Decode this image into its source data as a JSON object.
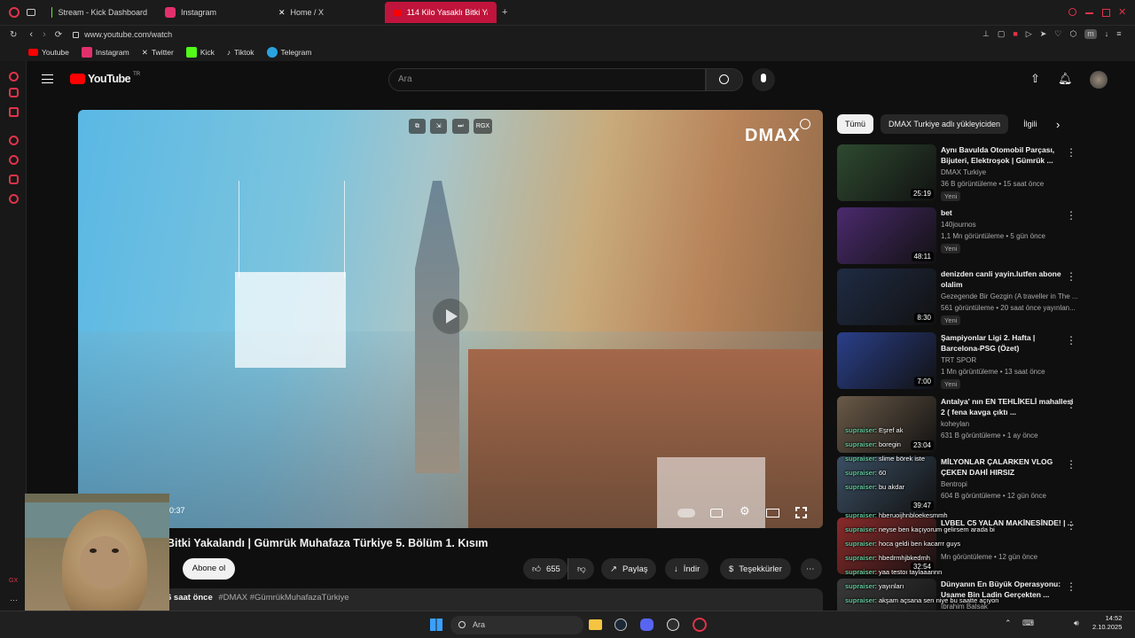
{
  "tabs": [
    {
      "label": "Stream - Kick Dashboard",
      "color": "#53fc18"
    },
    {
      "label": "Instagram",
      "color": "#e1306c"
    },
    {
      "label": "Home / X",
      "color": "#ffffff"
    },
    {
      "label": "114 Kilo Yasaklı Bitki Yaka",
      "color": "#ff0000",
      "active": true
    }
  ],
  "address": {
    "url": "www.youtube.com/watch"
  },
  "bookmarks": [
    "Youtube",
    "Instagram",
    "Twitter",
    "Kick",
    "Tiktok",
    "Telegram"
  ],
  "youtube": {
    "logo": "YouTube",
    "region": "TR",
    "search_placeholder": "Ara"
  },
  "player": {
    "brand": "DMAX",
    "time": "0:37",
    "ctrl_labels": [
      "⧉",
      "⇲",
      "⏭",
      "RGX"
    ]
  },
  "video": {
    "title": "Bitki Yakalandı | Gümrük Muhafaza Türkiye 5. Bölüm 1. Kısım",
    "subscribe": "Abone ol",
    "likes": "655",
    "share": "Paylaş",
    "download": "İndir",
    "thanks": "Teşekkürler",
    "desc_time": "6 saat önce",
    "desc_tags": "#DMAX #GümrükMuhafazaTürkiye"
  },
  "chips": [
    "Tümü",
    "DMAX Turkiye adlı yükleyiciden",
    "İlgili"
  ],
  "recommendations": [
    {
      "title": "Aynı Bavulda Otomobil Parçası, Bijuteri, Elektroşok | Gümrük ...",
      "channel": "DMAX Turkiye",
      "meta": "36 B görüntüleme • 15 saat önce",
      "badge": "Yeni",
      "duration": "25:19",
      "thumb": "#2e4a30"
    },
    {
      "title": "bet",
      "channel": "140journos",
      "meta": "1,1 Mn görüntüleme • 5 gün önce",
      "badge": "Yeni",
      "duration": "48:11",
      "thumb": "#4b2a6e"
    },
    {
      "title": "denizden canli yayin.lutfen abone olalim",
      "channel": "Gezegende Bir Gezgin (A traveller in The ...",
      "meta": "561 görüntüleme • 20 saat önce yayınlan...",
      "badge": "Yeni",
      "duration": "8:30",
      "thumb": "#1f2b44"
    },
    {
      "title": "Şampiyonlar Ligi 2. Hafta | Barcelona-PSG (Özet)",
      "channel": "TRT SPOR",
      "meta": "1 Mn görüntüleme • 13 saat önce",
      "badge": "Yeni",
      "duration": "7:00",
      "thumb": "#2a3f8a"
    },
    {
      "title": "Antalya' nın EN TEHLİKELİ mahallesi 2 ( fena kavga çıktı ...",
      "channel": "koheylan",
      "meta": "631 B görüntüleme • 1 ay önce",
      "badge": "",
      "duration": "23:04",
      "thumb": "#6a5a48"
    },
    {
      "title": "MİLYONLAR ÇALARKEN VLOG ÇEKEN DAHİ HIRSIZ",
      "channel": "Bentropi",
      "meta": "604 B görüntüleme • 12 gün önce",
      "badge": "",
      "duration": "39:47",
      "thumb": "#3b4f63"
    },
    {
      "title": "LVBEL C5 YALAN MAKİNESİNDE! | ...",
      "channel": "",
      "meta": "Mn görüntüleme • 12 gün önce",
      "badge": "",
      "duration": "32:54",
      "thumb": "#8a2a2a"
    },
    {
      "title": "Dünyanın En Büyük Operasyonu: Usame Bin Ladin Gerçekten ...",
      "channel": "İbrahim Balsak",
      "meta": "",
      "badge": "",
      "duration": "",
      "thumb": "#3a3a3a"
    }
  ],
  "chat": [
    {
      "name": "supraiser",
      "msg": ": Eşref ak"
    },
    {
      "name": "supraiser",
      "msg": ": boregin"
    },
    {
      "name": "supraiser",
      "msg": ": slime börek iste"
    },
    {
      "name": "supraiser",
      "msg": ": 60"
    },
    {
      "name": "supraiser",
      "msg": ": bu akdar"
    },
    {
      "name": "supraiser",
      "msg": ": hberuoijhnbloekesmmh"
    },
    {
      "name": "supraiser",
      "msg": ": neyse ben kaçıyorum gelirsem arada bi"
    },
    {
      "name": "supraiser",
      "msg": ": hoca geldi ben kacarrr guys"
    },
    {
      "name": "supraiser",
      "msg": ": hbedrmhjbkedmh"
    },
    {
      "name": "supraiser",
      "msg": ": yaa testoı taylaaannn"
    },
    {
      "name": "supraiser",
      "msg": ": yayınları"
    },
    {
      "name": "supraiser",
      "msg": ": akşam açsana sen niye bu saatte açıyon"
    },
    {
      "name": "supraiser",
      "msg": ": hmm"
    },
    {
      "name": "supraiser",
      "msg": ": slabtır"
    }
  ],
  "taskbar": {
    "search": "Ara",
    "time": "14:52",
    "date": "2.10.2025"
  }
}
